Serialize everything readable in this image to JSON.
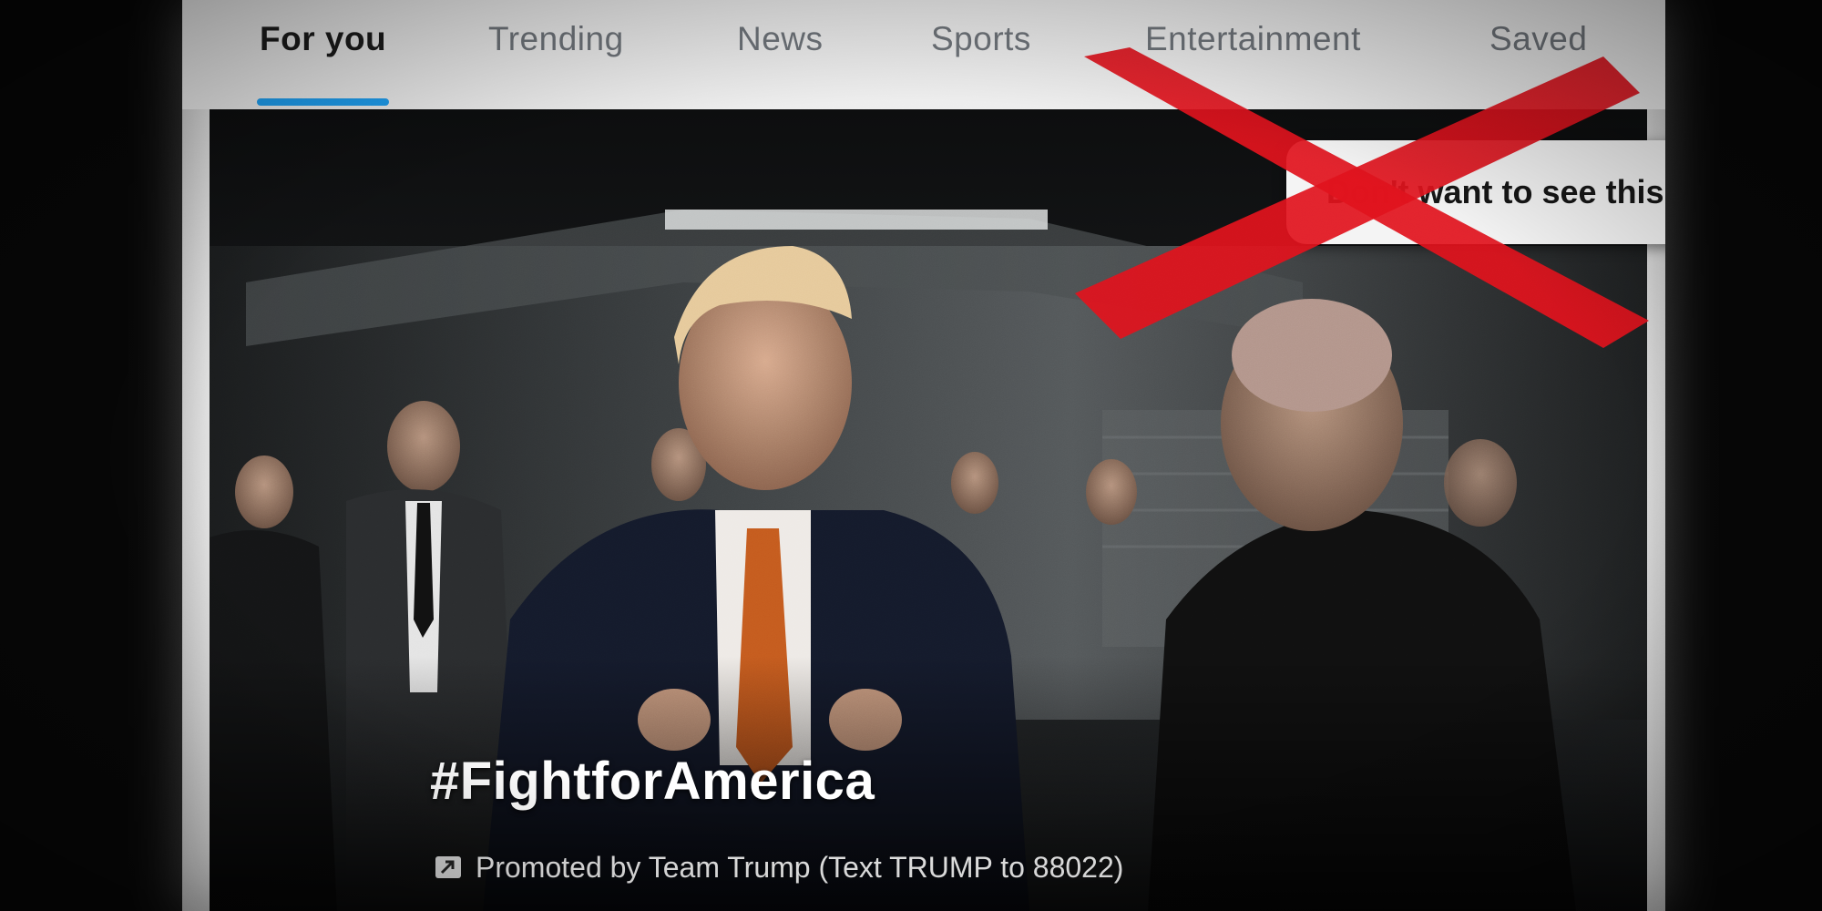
{
  "tabs": [
    {
      "label": "For you",
      "active": true
    },
    {
      "label": "Trending",
      "active": false
    },
    {
      "label": "News",
      "active": false
    },
    {
      "label": "Sports",
      "active": false
    },
    {
      "label": "Entertainment",
      "active": false
    },
    {
      "label": "Saved",
      "active": false
    }
  ],
  "ad": {
    "menu_option": "Don't want to see this ad",
    "hashtag": "#FightforAmerica",
    "promoted_text": "Promoted by Team Trump (Text TRUMP to 88022)",
    "promoted_icon": "promoted-icon"
  },
  "overlay": {
    "cross_out_color": "#e0121c",
    "cross_out_icon": "red-x-icon"
  },
  "colors": {
    "accent": "#1d9bf0",
    "tab_active": "#1a1a1a",
    "tab_inactive": "#6b7076"
  }
}
